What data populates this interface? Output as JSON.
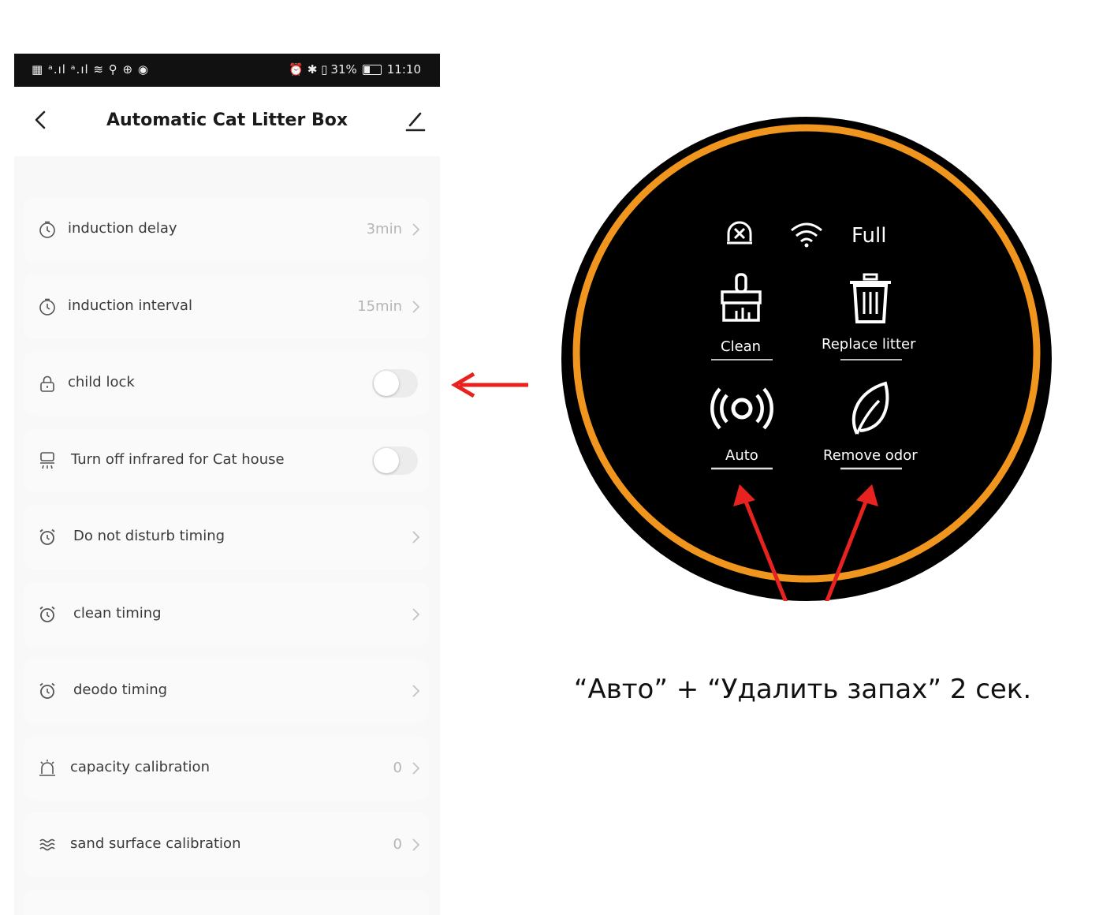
{
  "status_bar": {
    "left_icons": "▦ ᵃ.ıl ᵃ.ıl ≋ ⚲ ⊕ ◉",
    "alarm_bt_vibe": "⏰ ✱ ▯",
    "battery": "31%",
    "time": "11:10"
  },
  "header": {
    "title": "Automatic Cat Litter Box",
    "back_icon": "chevron-left",
    "edit_icon": "pencil"
  },
  "settings": [
    {
      "icon": "timer",
      "label": "induction delay",
      "value": "3min",
      "control": "chevron"
    },
    {
      "icon": "timer",
      "label": "induction interval",
      "value": "15min",
      "control": "chevron"
    },
    {
      "icon": "lock",
      "label": "child lock",
      "control": "toggle",
      "on": false
    },
    {
      "icon": "infrared",
      "label": "Turn off infrared for Cat house",
      "control": "toggle",
      "on": false
    },
    {
      "icon": "alarm-clock",
      "label": "Do not disturb timing",
      "control": "chevron"
    },
    {
      "icon": "alarm-clock",
      "label": "clean timing",
      "control": "chevron"
    },
    {
      "icon": "alarm-clock",
      "label": "deodo timing",
      "control": "chevron"
    },
    {
      "icon": "bell",
      "label": "capacity calibration",
      "value": "0",
      "control": "chevron"
    },
    {
      "icon": "waves",
      "label": "sand surface calibration",
      "value": "0",
      "control": "chevron"
    }
  ],
  "device": {
    "status_full": "Full",
    "buttons": [
      {
        "label": "Clean",
        "icon": "broom"
      },
      {
        "label": "Replace litter",
        "icon": "trash-can"
      },
      {
        "label": "Auto",
        "icon": "radio-waves"
      },
      {
        "label": "Remove odor",
        "icon": "leaf"
      }
    ],
    "ring_color": "#f0951e"
  },
  "annotation": {
    "caption": "“Авто” + “Удалить запах” 2 сек.",
    "arrow_color": "#e8231f"
  }
}
